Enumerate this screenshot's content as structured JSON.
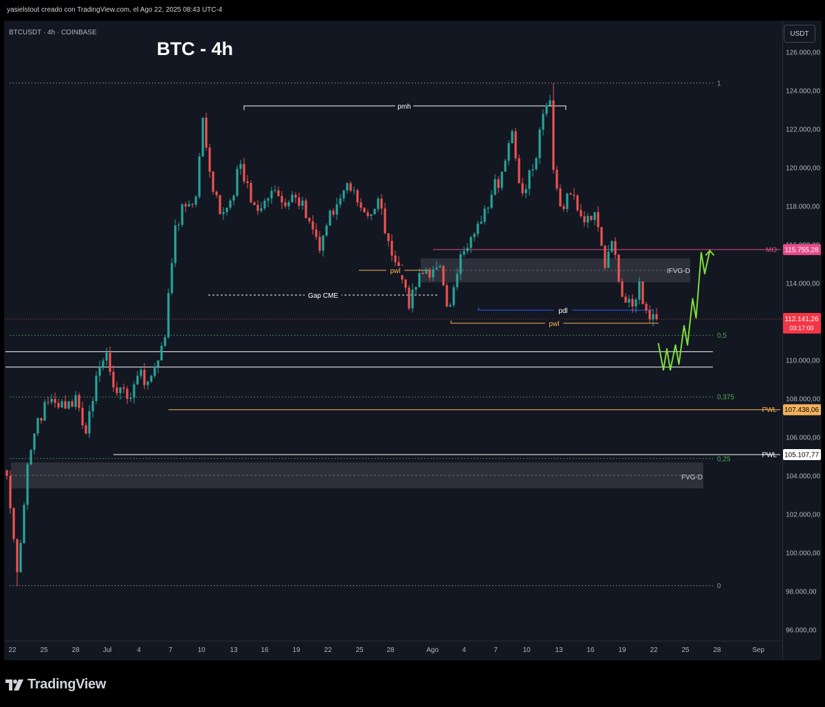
{
  "header": {
    "credit": "yasielstout creado con TradingView.com, el Ago 22, 2025 08:43 UTC-4"
  },
  "symbol_label": "BTCUSDT · 4h · COINBASE",
  "title": "BTC - 4h",
  "currency": "USDT",
  "brand": "TradingView",
  "colors": {
    "up": "#26a69a",
    "down": "#ef5350",
    "mo": "#e64a8b",
    "pwl": "#ffb74d",
    "pwl_dark": "#f5b25d",
    "green_path": "#7ee03a",
    "fib": "#4caf50",
    "pdl": "#2962ff"
  },
  "chart_data": {
    "type": "candlestick",
    "y_ticks": [
      "126.000,00",
      "124.000,00",
      "122.000,00",
      "120.000,00",
      "118.000,00",
      "116.000,00",
      "114.000,00",
      "112.000,00",
      "110.000,00",
      "108.000,00",
      "106.000,00",
      "104.000,00",
      "102.000,00",
      "100.000,00",
      "98.000,00",
      "96.000,00"
    ],
    "y_range": [
      95200,
      126700
    ],
    "x_ticks": [
      "22",
      "25",
      "28",
      "Jul",
      "4",
      "7",
      "10",
      "13",
      "16",
      "19",
      "22",
      "25",
      "28",
      "Ago",
      "4",
      "7",
      "10",
      "13",
      "16",
      "19",
      "22",
      "25",
      "28",
      "Sep"
    ],
    "price_anchors": [
      [
        0,
        104000
      ],
      [
        3,
        99000
      ],
      [
        6,
        104600
      ],
      [
        9,
        107000
      ],
      [
        13,
        108000
      ],
      [
        17,
        107500
      ],
      [
        20,
        108200
      ],
      [
        23,
        106200
      ],
      [
        26,
        109200
      ],
      [
        29,
        110400
      ],
      [
        32,
        108300
      ],
      [
        35,
        108000
      ],
      [
        38,
        109200
      ],
      [
        41,
        108900
      ],
      [
        44,
        110000
      ],
      [
        46,
        111200
      ],
      [
        47,
        113500
      ],
      [
        49,
        117000
      ],
      [
        52,
        118000
      ],
      [
        55,
        118500
      ],
      [
        57,
        122600
      ],
      [
        59,
        119800
      ],
      [
        62,
        117600
      ],
      [
        65,
        118300
      ],
      [
        68,
        120200
      ],
      [
        71,
        118200
      ],
      [
        74,
        117900
      ],
      [
        77,
        118800
      ],
      [
        80,
        118200
      ],
      [
        83,
        118600
      ],
      [
        86,
        118300
      ],
      [
        89,
        116800
      ],
      [
        91,
        115700
      ],
      [
        93,
        117000
      ],
      [
        96,
        118100
      ],
      [
        99,
        119200
      ],
      [
        102,
        118200
      ],
      [
        105,
        117500
      ],
      [
        108,
        118400
      ],
      [
        111,
        116200
      ],
      [
        113,
        115100
      ],
      [
        115,
        114200
      ],
      [
        117,
        112700
      ],
      [
        119,
        113800
      ],
      [
        121,
        114500
      ],
      [
        123,
        114300
      ],
      [
        126,
        114900
      ],
      [
        128,
        112800
      ],
      [
        130,
        113800
      ],
      [
        132,
        115500
      ],
      [
        135,
        116400
      ],
      [
        138,
        117200
      ],
      [
        141,
        118600
      ],
      [
        144,
        119800
      ],
      [
        147,
        121900
      ],
      [
        149,
        119200
      ],
      [
        151,
        118900
      ],
      [
        154,
        120500
      ],
      [
        156,
        122800
      ],
      [
        158,
        123500
      ],
      [
        159,
        119900
      ],
      [
        161,
        118000
      ],
      [
        164,
        118600
      ],
      [
        166,
        117800
      ],
      [
        169,
        117500
      ],
      [
        171,
        117700
      ],
      [
        174,
        114800
      ],
      [
        176,
        116200
      ],
      [
        178,
        114100
      ],
      [
        180,
        113000
      ],
      [
        182,
        112800
      ],
      [
        184,
        114100
      ],
      [
        186,
        112600
      ],
      [
        188,
        112400
      ],
      [
        189,
        112140
      ]
    ],
    "extremes": {
      "high": [
        159,
        124400
      ],
      "low": [
        3,
        98300
      ]
    },
    "levels": [
      {
        "label": "MO",
        "price": 115755.28,
        "value_label": "115.755,28"
      },
      {
        "label": "PWL",
        "price": 107438.06,
        "value_label": "107.438,06"
      },
      {
        "label": "PWL",
        "price": 105107.77,
        "value_label": "105.107,77"
      }
    ],
    "current": {
      "value_label": "112.141,26",
      "countdown": "03:17:00",
      "price": 112141.26
    },
    "fib_labels": [
      {
        "label": "1",
        "price": 124400
      },
      {
        "label": "0,5",
        "price": 111300
      },
      {
        "label": "0,375",
        "price": 108100
      },
      {
        "label": "0,25",
        "price": 104900
      },
      {
        "label": "0",
        "price": 98300
      }
    ],
    "annotations": {
      "pmh": "pmh",
      "pwl": "pwl",
      "gap": "Gap CME",
      "pdl": "pdl",
      "ifvg": "IFVG-D",
      "fvg": "FVG-D"
    },
    "projection": [
      [
        189.5,
        110900
      ],
      [
        191,
        109500
      ],
      [
        192,
        110600
      ],
      [
        193,
        109500
      ],
      [
        194.5,
        110800
      ],
      [
        195.5,
        109800
      ],
      [
        197,
        111800
      ],
      [
        198,
        110800
      ],
      [
        199.5,
        113200
      ],
      [
        200.5,
        112200
      ],
      [
        202,
        115600
      ],
      [
        203,
        114500
      ],
      [
        204.5,
        115700
      ]
    ],
    "white_levels": [
      110450,
      109650
    ],
    "ifvg_zone": [
      114050,
      115300
    ],
    "fvg_zone": [
      103350,
      104700
    ]
  }
}
